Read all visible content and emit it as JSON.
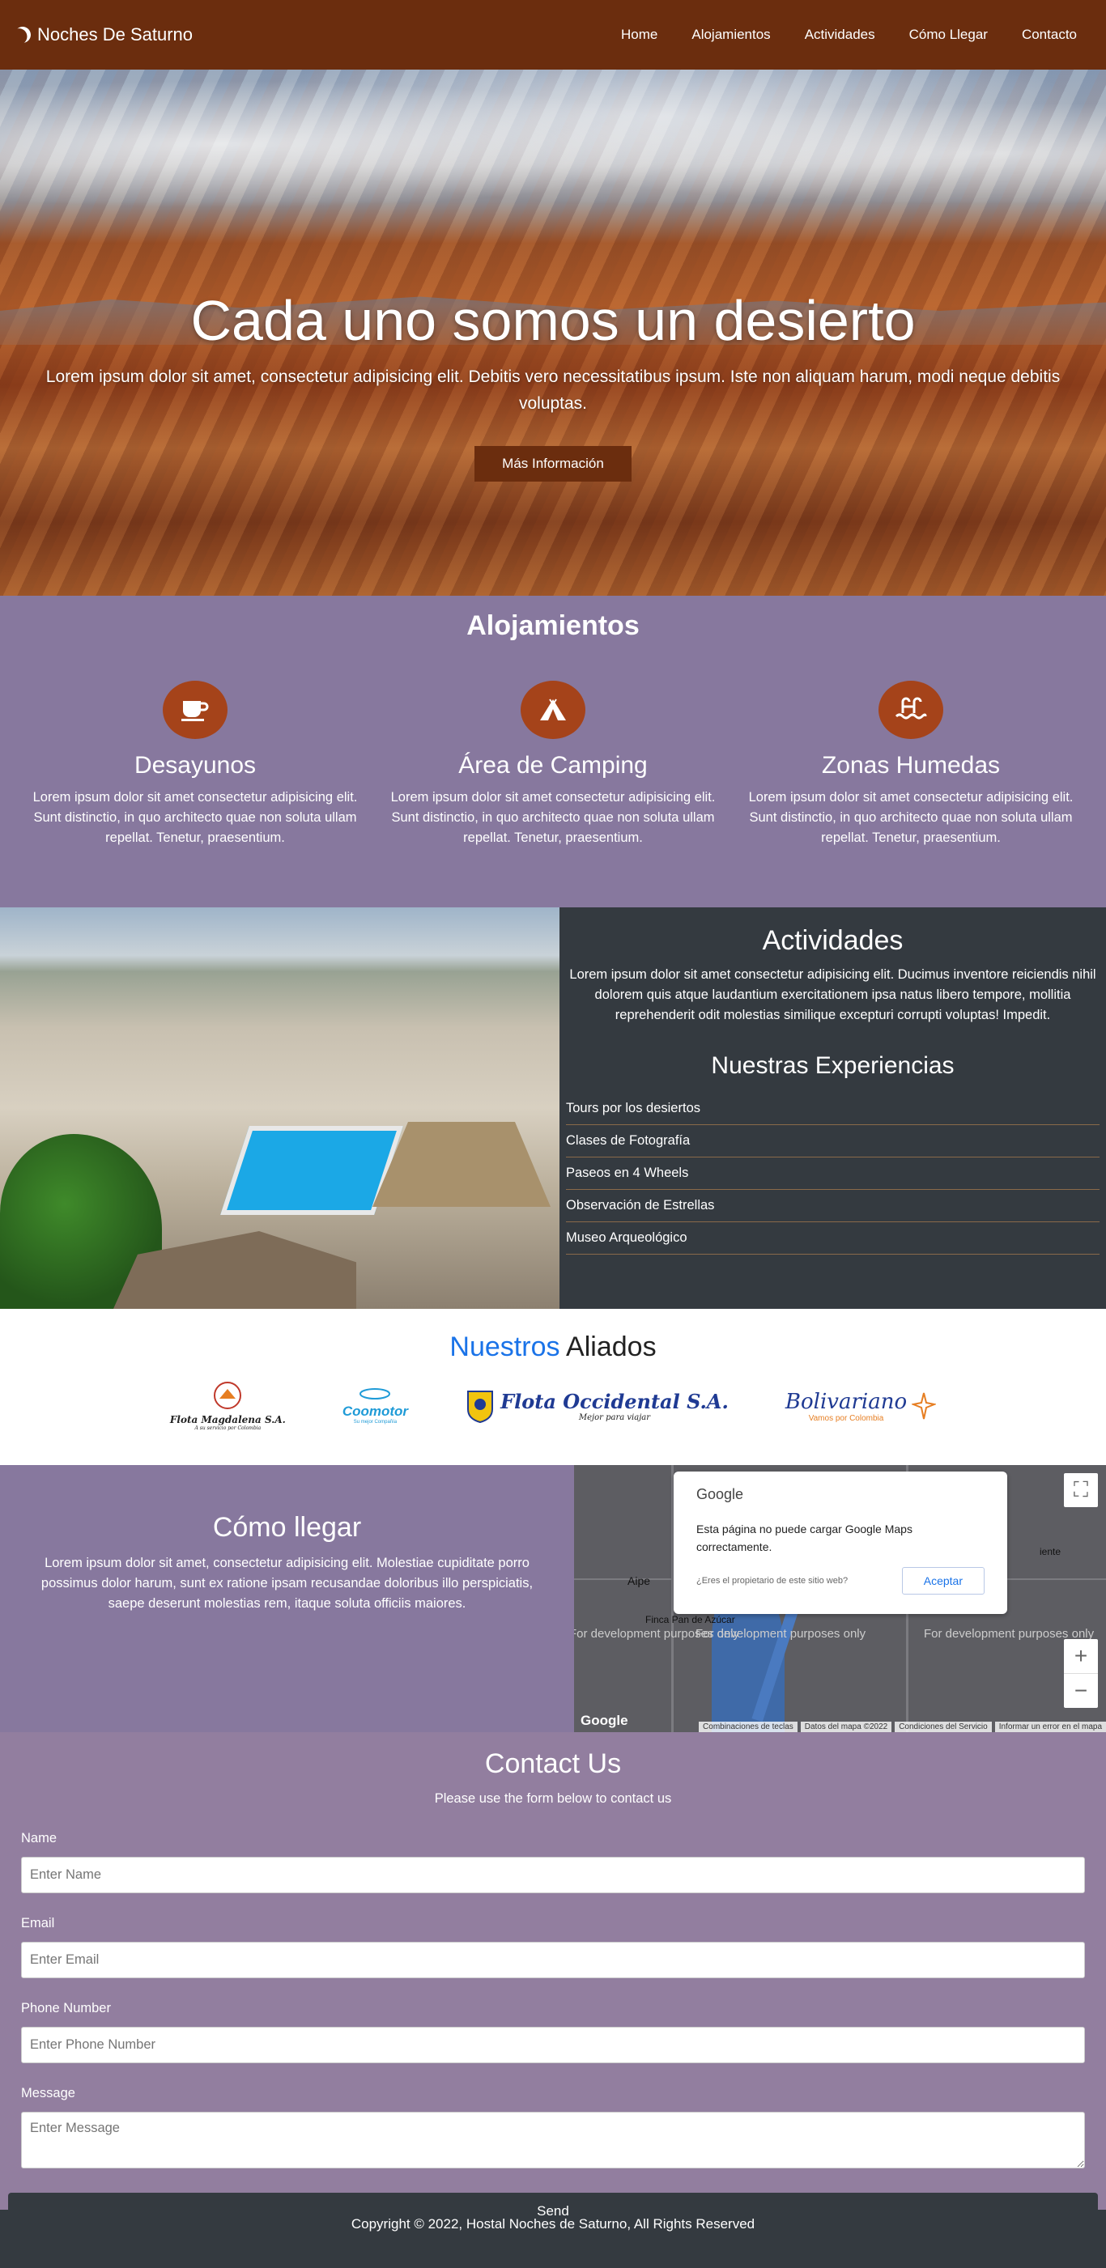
{
  "nav": {
    "brand": "Noches De Saturno",
    "links": [
      "Home",
      "Alojamientos",
      "Actividades",
      "Cómo Llegar",
      "Contacto"
    ]
  },
  "hero": {
    "title": "Cada uno somos un desierto",
    "text": "Lorem ipsum dolor sit amet, consectetur adipisicing elit. Debitis vero necessitatibus ipsum. Iste non aliquam harum, modi neque debitis voluptas.",
    "button": "Más Información"
  },
  "alojamientos": {
    "title": "Alojamientos",
    "items": [
      {
        "icon": "coffee-icon",
        "title": "Desayunos",
        "text": "Lorem ipsum dolor sit amet consectetur adipisicing elit. Sunt distinctio, in quo architecto quae non soluta ullam repellat. Tenetur, praesentium."
      },
      {
        "icon": "tent-icon",
        "title": "Área de Camping",
        "text": "Lorem ipsum dolor sit amet consectetur adipisicing elit. Sunt distinctio, in quo architecto quae non soluta ullam repellat. Tenetur, praesentium."
      },
      {
        "icon": "swimming-icon",
        "title": "Zonas Humedas",
        "text": "Lorem ipsum dolor sit amet consectetur adipisicing elit. Sunt distinctio, in quo architecto quae non soluta ullam repellat. Tenetur, praesentium."
      }
    ]
  },
  "actividades": {
    "title": "Actividades",
    "text": "Lorem ipsum dolor sit amet consectetur adipisicing elit. Ducimus inventore reiciendis nihil dolorem quis atque laudantium exercitationem ipsa natus libero tempore, mollitia reprehenderit odit molestias similique excepturi corrupti voluptas! Impedit.",
    "subtitle": "Nuestras Experiencias",
    "list": [
      "Tours por los desiertos",
      "Clases de Fotografía",
      "Paseos en 4 Wheels",
      "Observación de Estrellas",
      "Museo Arqueológico"
    ]
  },
  "aliados": {
    "title_highlight": "Nuestros",
    "title_rest": " Aliados",
    "logos": [
      {
        "name": "Flota Magdalena S.A.",
        "tagline": "A su servicio por Colombia"
      },
      {
        "name": "Coomotor",
        "tagline": "Su mejor Compañía"
      },
      {
        "name": "Flota Occidental S.A.",
        "tagline": "Mejor para viajar"
      },
      {
        "name": "Bolivariano",
        "tagline": "Vamos por Colombia"
      }
    ]
  },
  "llegar": {
    "title": "Cómo llegar",
    "text": "Lorem ipsum dolor sit amet, consectetur adipisicing elit. Molestiae cupiditate porro possimus dolor harum, sunt ex ratione ipsam recusandae doloribus illo perspiciatis, saepe deserunt molestias rem, itaque soluta officiis maiores."
  },
  "map": {
    "brand": "Google",
    "message": "Esta página no puede cargar Google Maps correctamente.",
    "question": "¿Eres el propietario de este sitio web?",
    "accept": "Aceptar",
    "dev_text": "For development purposes only",
    "places": [
      "Aipe",
      "Finca Pan de Azúcar",
      "iente"
    ],
    "footer": [
      "Combinaciones de teclas",
      "Datos del mapa ©2022",
      "Condiciones del Servicio",
      "Informar un error en el mapa"
    ],
    "logo": "Google"
  },
  "contact": {
    "title": "Contact Us",
    "subtitle": "Please use the form below to contact us",
    "fields": [
      {
        "label": "Name",
        "placeholder": "Enter Name"
      },
      {
        "label": "Email",
        "placeholder": "Enter Email"
      },
      {
        "label": "Phone Number",
        "placeholder": "Enter Phone Number"
      },
      {
        "label": "Message",
        "placeholder": "Enter Message"
      }
    ],
    "send": "Send"
  },
  "footer": {
    "text": "Copyright © 2022, Hostal Noches de Saturno, All Rights Reserved"
  },
  "colors": {
    "nav": "#6b2d0e",
    "purple": "#87789e",
    "dark": "#343a40",
    "accent_blue": "#1a73e8"
  }
}
